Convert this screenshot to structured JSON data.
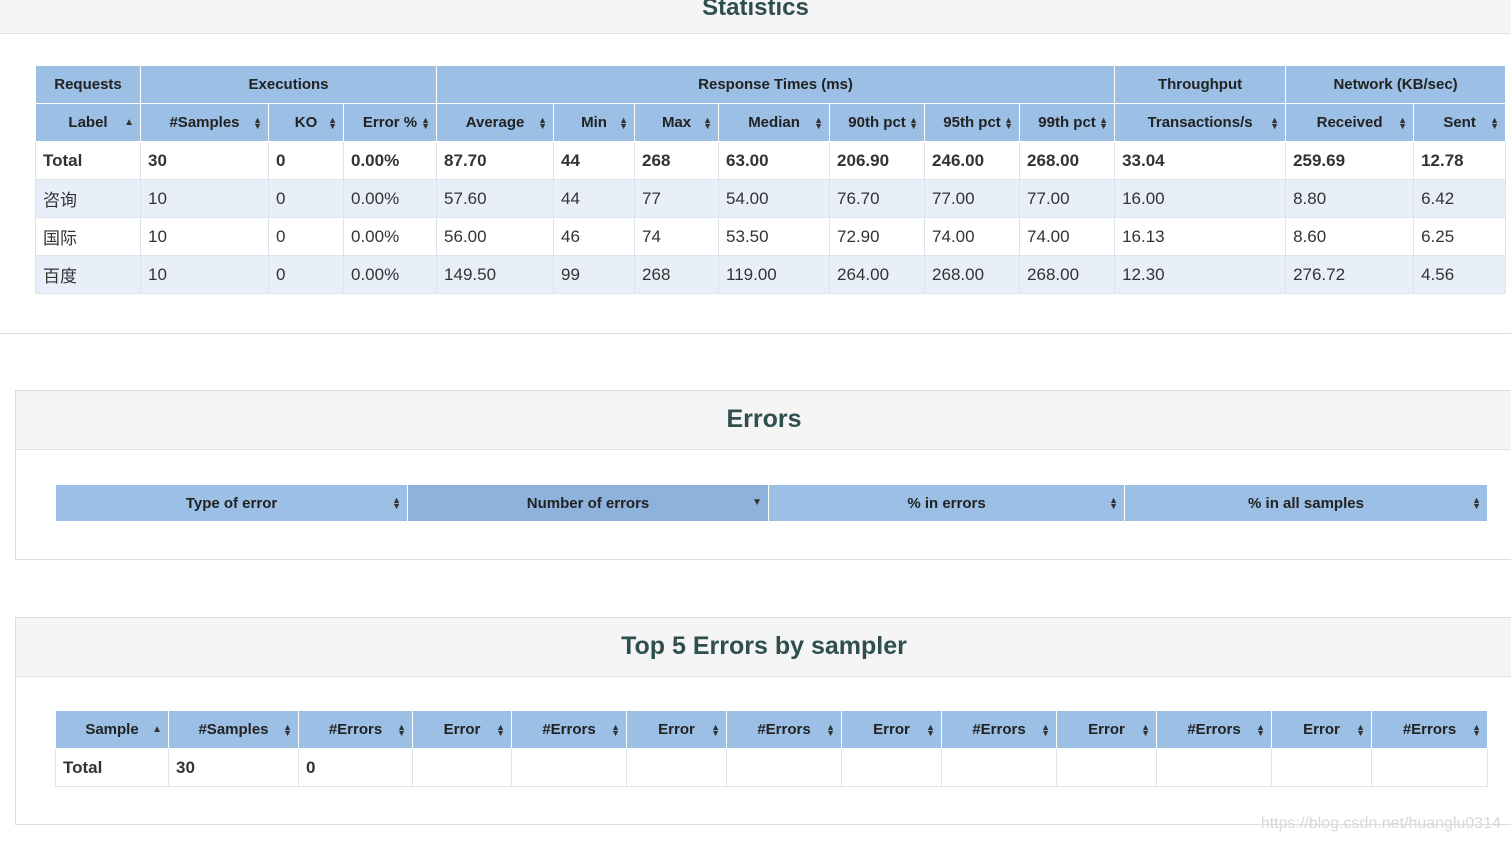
{
  "statistics": {
    "title": "Statistics",
    "group_headers": [
      "Requests",
      "Executions",
      "Response Times (ms)",
      "Throughput",
      "Network (KB/sec)"
    ],
    "columns": [
      "Label",
      "#Samples",
      "KO",
      "Error %",
      "Average",
      "Min",
      "Max",
      "Median",
      "90th pct",
      "95th pct",
      "99th pct",
      "Transactions/s",
      "Received",
      "Sent"
    ],
    "total": [
      "Total",
      "30",
      "0",
      "0.00%",
      "87.70",
      "44",
      "268",
      "63.00",
      "206.90",
      "246.00",
      "268.00",
      "33.04",
      "259.69",
      "12.78"
    ],
    "rows": [
      [
        "咨询",
        "10",
        "0",
        "0.00%",
        "57.60",
        "44",
        "77",
        "54.00",
        "76.70",
        "77.00",
        "77.00",
        "16.00",
        "8.80",
        "6.42"
      ],
      [
        "国际",
        "10",
        "0",
        "0.00%",
        "56.00",
        "46",
        "74",
        "53.50",
        "72.90",
        "74.00",
        "74.00",
        "16.13",
        "8.60",
        "6.25"
      ],
      [
        "百度",
        "10",
        "0",
        "0.00%",
        "149.50",
        "99",
        "268",
        "119.00",
        "264.00",
        "268.00",
        "268.00",
        "12.30",
        "276.72",
        "4.56"
      ]
    ]
  },
  "errors": {
    "title": "Errors",
    "columns": [
      "Type of error",
      "Number of errors",
      "% in errors",
      "% in all samples"
    ]
  },
  "top5": {
    "title": "Top 5 Errors by sampler",
    "columns": [
      "Sample",
      "#Samples",
      "#Errors",
      "Error",
      "#Errors",
      "Error",
      "#Errors",
      "Error",
      "#Errors",
      "Error",
      "#Errors",
      "Error",
      "#Errors"
    ],
    "total": [
      "Total",
      "30",
      "0",
      "",
      "",
      "",
      "",
      "",
      "",
      "",
      "",
      "",
      ""
    ]
  },
  "watermark": "https://blog.csdn.net/huanglu0314",
  "colors": {
    "header_bg": "#9bbfe5",
    "active_header_bg": "#8db3dd",
    "odd_row_bg": "#e8eff8",
    "title_color": "#2f4f4f"
  },
  "icons": {
    "sortable": "sort-both-icon",
    "sort_asc": "sort-asc-icon",
    "sort_desc": "sort-desc-icon"
  }
}
